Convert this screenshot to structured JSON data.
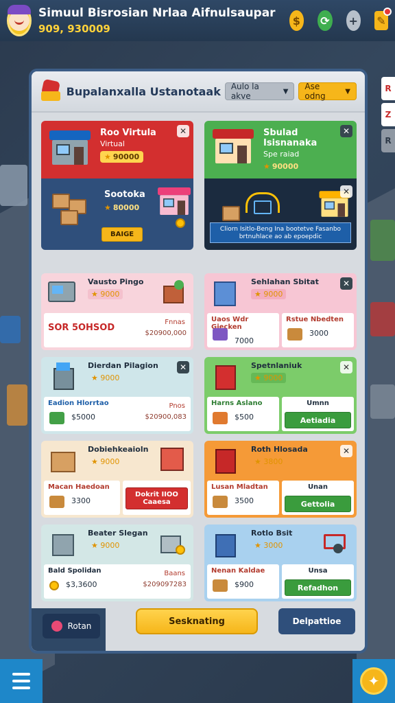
{
  "app": {
    "title": "Simuul Bisrosian Nrlaa Aifnulsaupar",
    "coins": "909, 930009"
  },
  "topbar": {
    "coin_icon": "coin-icon",
    "refresh_icon": "refresh-icon",
    "plus_icon": "plus-icon",
    "notes_icon": "notes-icon"
  },
  "side_tabs": [
    "R",
    "Z",
    "R"
  ],
  "panel": {
    "title": "Bupalanxalla Ustanotaak",
    "dropdown1": "Aulo la akve",
    "dropdown2": "Ase odng"
  },
  "featured": [
    {
      "top_name": "Roo Virtula",
      "top_sub": "Virtual",
      "top_price": "90000",
      "bot_name": "Sootoka",
      "bot_price": "80000",
      "buy_label": "BAIGE",
      "colors": {
        "top": "#d32f2f",
        "bottom": "#2f4f7b"
      }
    },
    {
      "top_name": "Sbulad Isisnanaka",
      "top_sub": "Spe raiad",
      "top_price": "90000",
      "banner": "Cliorn Isitlo-Beng Ina bootetve Fasanbo brtnuhlace ao ab epoepdic",
      "colors": {
        "top": "#4caf50",
        "bottom": "#1b2b3f"
      }
    }
  ],
  "items": [
    {
      "name": "Vausto Pingo",
      "price": "9000",
      "left_label": "",
      "left_value": "SOR 5OHSOD",
      "right_label": "Fnnas",
      "right_value": "$20900,000",
      "bg": "#f8d4dc"
    },
    {
      "name": "Sehlahan Sbitat",
      "price": "9000",
      "left_label": "Uaos Wdr Giecken",
      "left_value": "7000",
      "right_label": "Rstue Nbedten",
      "right_value": "3000",
      "bg": "#f7c6d4"
    },
    {
      "name": "Dierdan Pilagion",
      "price": "9000",
      "left_label": "Eadion Hlorrtao",
      "left_value": "$5000",
      "right_label": "Pnos",
      "right_value": "$20900,083",
      "bg": "#cfe6ea"
    },
    {
      "name": "Spetnlaniuk",
      "price": "9000",
      "left_label": "Harns Aslano",
      "left_value": "$500",
      "right_label": "Umnn",
      "right_value": "Aetiadia",
      "bg": "#7ccc6a"
    },
    {
      "name": "Dobiehkeaioln",
      "price": "9000",
      "left_label": "Macan Haedoan",
      "left_value": "3300",
      "right_label": "Dokrit IIOO",
      "right_value": "Caaesa",
      "bg": "#f7e7cf"
    },
    {
      "name": "Roth Hlosada",
      "price": "3800",
      "left_label": "Lusan Mladtan",
      "left_value": "3500",
      "right_label": "Unan",
      "right_value": "Gettolia",
      "bg": "#f59a37"
    },
    {
      "name": "Beater Slegan",
      "price": "9000",
      "left_label": "Bald Spolidan",
      "left_value": "$3,3600",
      "right_label": "Baans",
      "right_value": "$209097283",
      "bg": "#d3e7e6"
    },
    {
      "name": "Rotlo Bsit",
      "price": "3000",
      "left_label": "Nenan Kaldae",
      "left_value": "$900",
      "right_label": "Unsa",
      "right_value": "Refadhon",
      "bg": "#a9d1ef"
    }
  ],
  "footer": {
    "rotate_label": "Rotan",
    "main_label": "Sesknating",
    "dept_label": "Delpattioe"
  }
}
